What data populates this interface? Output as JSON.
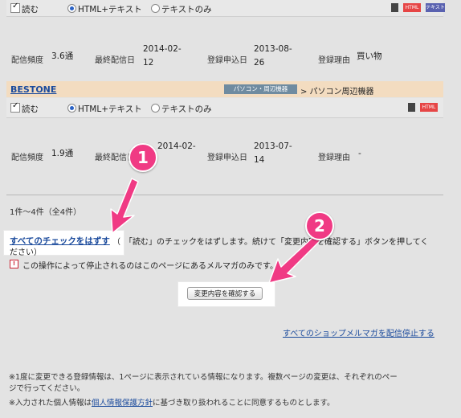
{
  "items": [
    {
      "read_label": "読む",
      "format_html": "HTML+テキスト",
      "format_text": "テキストのみ",
      "badges": [
        "",
        "HTML",
        "テキスト"
      ],
      "freq_label": "配信頻度",
      "freq_value": "3.6通",
      "last_label": "最終配信日",
      "last_value": "2014-02-12",
      "signup_label": "登録申込日",
      "signup_value": "2013-08-26",
      "reason_label": "登録理由",
      "reason_value": "買い物"
    },
    {
      "shop_name": "BESTONE",
      "category_tag": "パソコン・周辺機器",
      "category_text": "> パソコン周辺機器",
      "read_label": "読む",
      "format_html": "HTML+テキスト",
      "format_text": "テキストのみ",
      "badges": [
        "",
        "HTML"
      ],
      "freq_label": "配信頻度",
      "freq_value": "1.9通",
      "last_label": "最終配信日",
      "last_value": "2014-02-",
      "signup_label": "登録申込日",
      "signup_value": "2013-07-14",
      "reason_label": "登録理由",
      "reason_value": "-"
    }
  ],
  "pagination": {
    "count_text": "1件〜4件（全4件）"
  },
  "uncheck": {
    "link_text": "すべてのチェックをはずす",
    "desc_open": "（",
    "desc_line1": "「読む」のチェックをはずします。続けて「変更内容を確認する」ボタンを押してく",
    "desc_line2": "ださい）"
  },
  "warning": {
    "icon": "!",
    "text": "この操作によって停止されるのはこのページにあるメルマガのみです。"
  },
  "confirm_button": "変更内容を確認する",
  "stop_all_link": "すべてのショップメルマガを配信停止する",
  "footer": {
    "note1": "※1度に変更できる登録情報は、1ページに表示されている情報になります。複数ページの変更は、それぞれのペー",
    "note1b": "ジで行ってください。",
    "note2_pre": "※入力された個人情報は",
    "note2_link": "個人情報保護方針",
    "note2_post": "に基づき取り扱われることに同意するものとします。"
  },
  "annotations": {
    "marker1": "1",
    "marker2": "2"
  },
  "colors": {
    "accent": "#f03a84",
    "link": "#1a4a9c",
    "shop_header": "#f3dcc0",
    "badge_html": "#e64545",
    "badge_text": "#5a62b0"
  }
}
